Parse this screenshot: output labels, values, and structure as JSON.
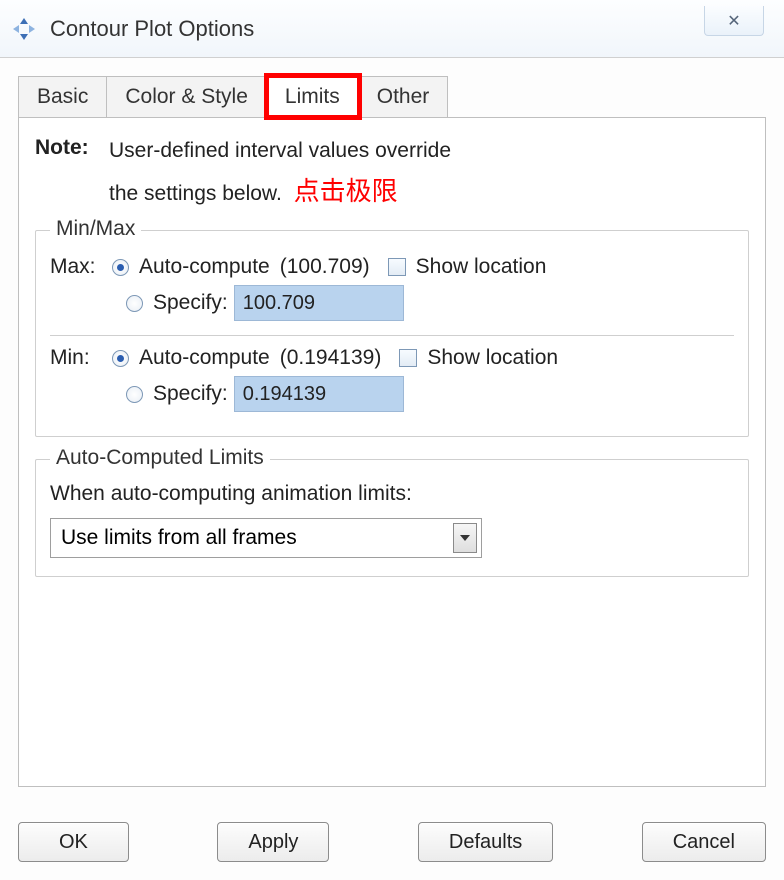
{
  "window": {
    "title": "Contour Plot Options",
    "close_glyph": "✕"
  },
  "tabs": [
    {
      "label": "Basic"
    },
    {
      "label": "Color & Style"
    },
    {
      "label": "Limits"
    },
    {
      "label": "Other"
    }
  ],
  "active_tab_index": 2,
  "note": {
    "label": "Note:",
    "line1": "User-defined interval values override",
    "line2": "the settings below.",
    "annotation": "点击极限"
  },
  "minmax": {
    "legend": "Min/Max",
    "max": {
      "label": "Max:",
      "auto_label": "Auto-compute",
      "auto_value": "(100.709)",
      "auto_selected": true,
      "show_location_label": "Show location",
      "show_location_checked": false,
      "specify_label": "Specify:",
      "specify_value": "100.709"
    },
    "min": {
      "label": "Min:",
      "auto_label": "Auto-compute",
      "auto_value": "(0.194139)",
      "auto_selected": true,
      "show_location_label": "Show location",
      "show_location_checked": false,
      "specify_label": "Specify:",
      "specify_value": "0.194139"
    }
  },
  "auto_limits": {
    "legend": "Auto-Computed Limits",
    "prompt": "When auto-computing animation limits:",
    "selected": "Use limits from all frames"
  },
  "buttons": {
    "ok": "OK",
    "apply": "Apply",
    "defaults": "Defaults",
    "cancel": "Cancel"
  }
}
